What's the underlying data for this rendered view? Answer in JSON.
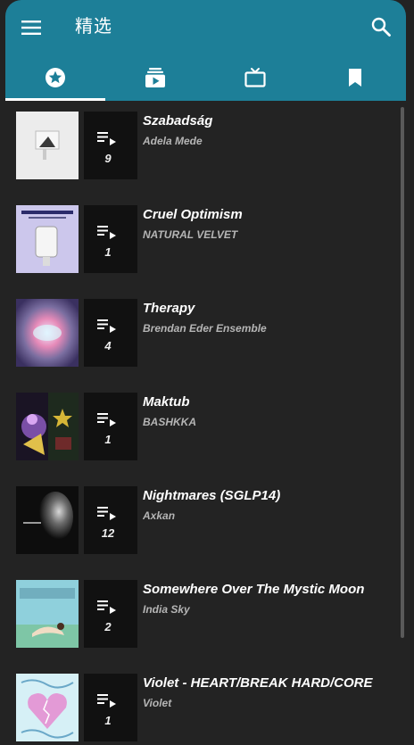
{
  "appbar": {
    "title": "精选",
    "color": "#1d7f98",
    "menu_icon": "menu-icon",
    "search_icon": "search-icon"
  },
  "tabs": [
    {
      "icon": "star-circle-icon",
      "selected": true
    },
    {
      "icon": "playlist-play-icon",
      "selected": false
    },
    {
      "icon": "tv-icon",
      "selected": false
    },
    {
      "icon": "bookmark-icon",
      "selected": false
    }
  ],
  "items": [
    {
      "title": "Szabadság",
      "artist": "Adela Mede",
      "count": "9"
    },
    {
      "title": "Cruel Optimism",
      "artist": "NATURAL VELVET",
      "count": "1"
    },
    {
      "title": "Therapy",
      "artist": "Brendan Eder Ensemble",
      "count": "4"
    },
    {
      "title": "Maktub",
      "artist": "BASHKKA",
      "count": "1"
    },
    {
      "title": "Nightmares (SGLP14)",
      "artist": "Axkan",
      "count": "12"
    },
    {
      "title": "Somewhere Over The Mystic Moon",
      "artist": "India Sky",
      "count": "2"
    },
    {
      "title": "Violet - HEART/BREAK HARD/CORE",
      "artist": "Violet",
      "count": "1"
    }
  ]
}
